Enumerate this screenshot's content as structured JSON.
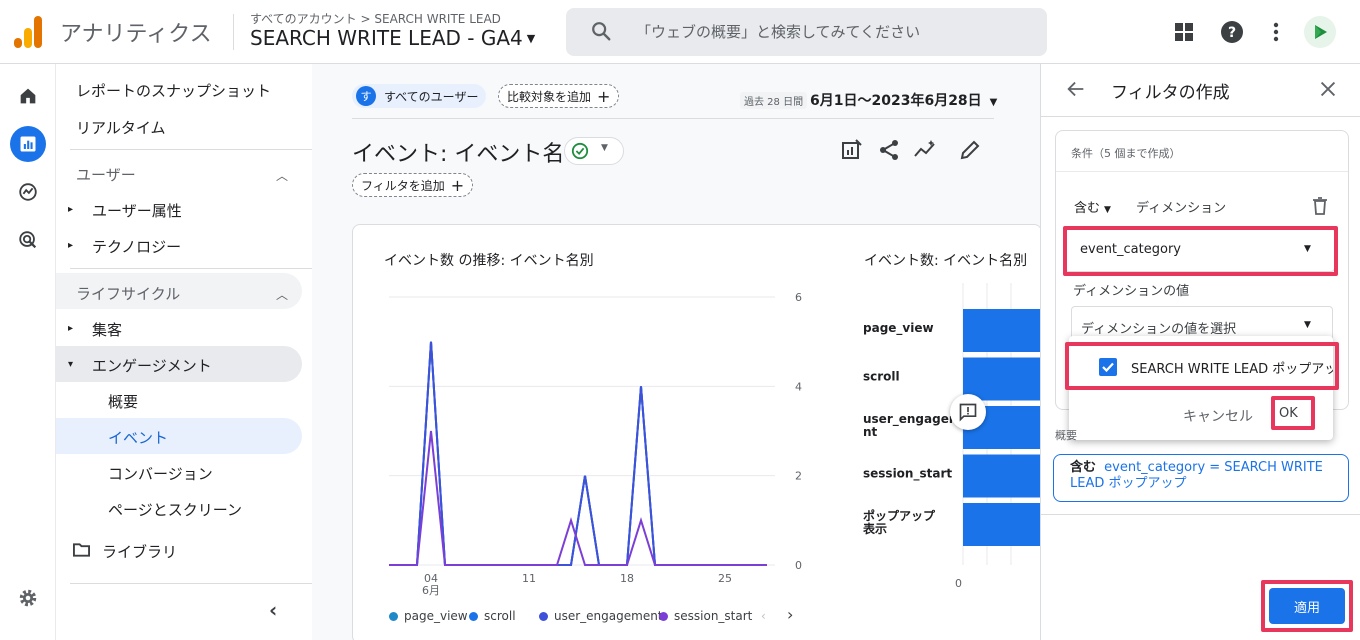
{
  "header": {
    "app_name": "アナリティクス",
    "breadcrumb": "すべてのアカウント > SEARCH WRITE LEAD",
    "property": "SEARCH WRITE LEAD - GA4",
    "search_placeholder": "「ウェブの概要」と検索してみてください"
  },
  "rail": {
    "items": [
      "home-icon",
      "reports-icon",
      "explore-icon",
      "advertising-icon"
    ],
    "settings": "gear-icon"
  },
  "nav": {
    "snapshot": "レポートのスナップショット",
    "realtime": "リアルタイム",
    "user_section": "ユーザー",
    "user_attributes": "ユーザー属性",
    "technology": "テクノロジー",
    "lifecycle_section": "ライフサイクル",
    "acquisition": "集客",
    "engagement": "エンゲージメント",
    "overview": "概要",
    "events": "イベント",
    "conversions": "コンバージョン",
    "pages_screens": "ページとスクリーン",
    "library": "ライブラリ"
  },
  "main": {
    "segment_initial": "す",
    "segment_label": "すべてのユーザー",
    "compare_label": "比較対象を追加",
    "date_prefix": "過去 28 日間",
    "date_range": "6月1日～2023年6月28日",
    "page_title": "イベント: イベント名",
    "add_filter": "フィルタを追加",
    "chart1_title": "イベント数 の推移: イベント名別",
    "chart2_title": "イベント数: イベント名別"
  },
  "chart_data": [
    {
      "type": "line",
      "title": "イベント数 の推移: イベント名別",
      "x_ticks": [
        "04",
        "11",
        "18",
        "25"
      ],
      "x_month_label": "6月",
      "ylim": [
        0,
        6
      ],
      "y_ticks": [
        "0",
        "2",
        "4",
        "6"
      ],
      "x": [
        1,
        2,
        3,
        4,
        5,
        6,
        7,
        8,
        9,
        10,
        11,
        12,
        13,
        14,
        15,
        16,
        17,
        18,
        19,
        20,
        21,
        22,
        23,
        24,
        25,
        26,
        27,
        28
      ],
      "series": [
        {
          "name": "page_view",
          "color": "#1e88c8",
          "values": [
            0,
            0,
            0,
            5,
            0,
            0,
            0,
            0,
            0,
            0,
            0,
            0,
            0,
            0,
            2,
            0,
            0,
            0,
            4,
            0,
            0,
            0,
            0,
            0,
            0,
            0,
            0,
            0
          ]
        },
        {
          "name": "scroll",
          "color": "#1a73e8",
          "values": [
            0,
            0,
            0,
            5,
            0,
            0,
            0,
            0,
            0,
            0,
            0,
            0,
            0,
            0,
            2,
            0,
            0,
            0,
            4,
            0,
            0,
            0,
            0,
            0,
            0,
            0,
            0,
            0
          ]
        },
        {
          "name": "user_engagement",
          "color": "#3f51d8",
          "values": [
            0,
            0,
            0,
            5,
            0,
            0,
            0,
            0,
            0,
            0,
            0,
            0,
            0,
            0,
            2,
            0,
            0,
            0,
            4,
            0,
            0,
            0,
            0,
            0,
            0,
            0,
            0,
            0
          ]
        },
        {
          "name": "session_start",
          "color": "#7b3fd6",
          "values": [
            0,
            0,
            0,
            3,
            0,
            0,
            0,
            0,
            0,
            0,
            0,
            0,
            0,
            1,
            0,
            0,
            0,
            0,
            1,
            0,
            0,
            0,
            0,
            0,
            0,
            0,
            0,
            0
          ]
        }
      ]
    },
    {
      "type": "bar",
      "title": "イベント数: イベント名別",
      "categories": [
        "page_view",
        "scroll",
        "user_engagement",
        "session_start",
        "ポップアップ表示"
      ],
      "category_display": [
        "page_view",
        "scroll",
        "user_engageme\nnt",
        "session_start",
        "ポップアップ\n表示"
      ],
      "values": [
        20,
        20,
        20,
        20,
        20
      ],
      "x_ticks": [
        "0"
      ],
      "color": "#1a73e8"
    }
  ],
  "panel": {
    "title": "フィルタの作成",
    "conditions_note": "条件（5 個まで作成）",
    "match_type": "含む",
    "dimension_label": "ディメンション",
    "dimension_value": "event_category",
    "values_label": "ディメンションの値",
    "values_placeholder": "ディメンションの値を選択",
    "option_label": "SEARCH WRITE LEAD ポップアップ",
    "cancel": "キャンセル",
    "ok": "OK",
    "summary_label": "概要",
    "summary_prefix": "含む",
    "summary_text": "event_category = SEARCH WRITE LEAD ポップアップ",
    "apply": "適用"
  },
  "colors": {
    "accent": "#1a73e8",
    "highlight": "#e8375c"
  }
}
